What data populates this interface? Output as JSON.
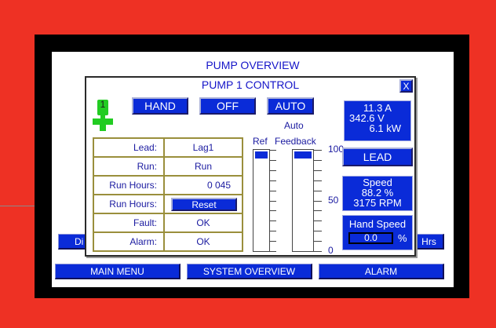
{
  "screen": {
    "title": "PUMP OVERVIEW",
    "left_clipped_button": "Di",
    "right_clipped_button": "Hrs",
    "nav": [
      "MAIN MENU",
      "SYSTEM OVERVIEW",
      "ALARM"
    ]
  },
  "popup": {
    "title": "PUMP 1 CONTROL",
    "close_label": "X",
    "pump_number": "1",
    "mode_buttons": [
      "HAND",
      "OFF",
      "AUTO"
    ],
    "status_rows": [
      {
        "label": "Lead:",
        "value": "Lag1"
      },
      {
        "label": "Run:",
        "value": "Run"
      },
      {
        "label": "Run Hours:",
        "value": "0 045"
      },
      {
        "label": "Run Hours:",
        "value": "Reset"
      },
      {
        "label": "Fault:",
        "value": "OK"
      },
      {
        "label": "Alarm:",
        "value": "OK"
      }
    ],
    "bars": {
      "ref_label": "Ref",
      "auto_label": "Auto",
      "feedback_label": "Feedback",
      "scale": [
        "100",
        "50",
        "0"
      ],
      "ref_level": 0.07,
      "feedback_level": 0.07
    },
    "readings": {
      "current": "11.3  A",
      "voltage": "342.6  V",
      "power": "6.1  kW"
    },
    "lead_button": "LEAD",
    "speed": {
      "title": "Speed",
      "percent": "88.2  %",
      "rpm": "3175  RPM"
    },
    "hand_speed": {
      "title": "Hand Speed",
      "value": "0.0",
      "unit": "%"
    },
    "colors": {
      "button_blue": "#0a2bd8",
      "frame_red": "#ee3124",
      "pump_green": "#22cc22"
    }
  }
}
